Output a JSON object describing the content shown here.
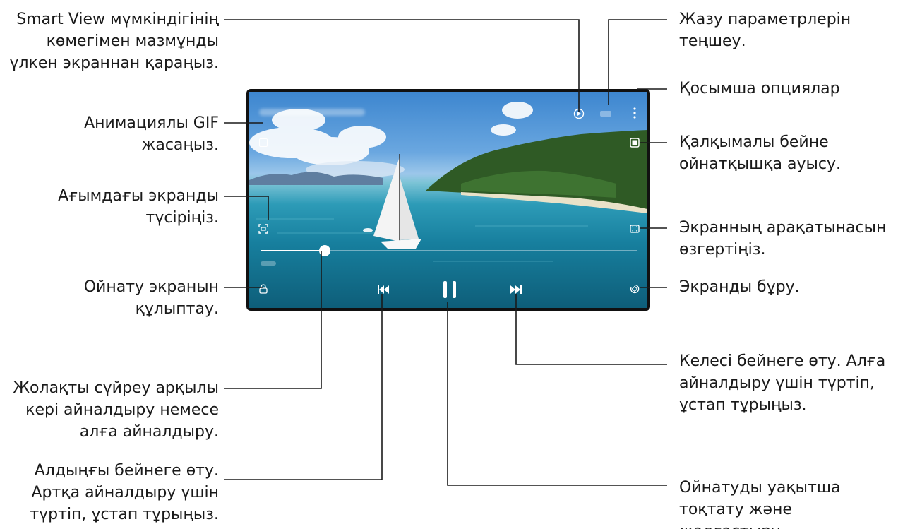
{
  "player": {
    "progress_fraction": 0.17,
    "colors": {
      "accent": "#ffffff",
      "callout_line": "#1a1a1a",
      "water": "#177f9e",
      "sky": "#3d86cf"
    },
    "icons": {
      "smart_view": "smart-view-icon",
      "hdr": "hdr-icon",
      "more": "more-options-icon",
      "gif": "gif-icon",
      "popup": "popup-player-icon",
      "capture": "capture-icon",
      "ratio": "screen-ratio-icon",
      "lock": "lock-icon",
      "rotate": "rotate-icon",
      "previous": "previous-icon",
      "pause": "pause-icon",
      "next": "next-icon"
    }
  },
  "callouts": {
    "smart_view": "Smart View мүмкіндігінің\nкөмегімен мазмұнды\nүлкен экраннан қараңыз.",
    "gif": "Анимациялы GIF\nжасаңыз.",
    "capture": "Ағымдағы экранды\nтүсіріңіз.",
    "lock": "Ойнату экранын\nқұлыптау.",
    "seek": "Жолақты сүйреу арқылы\nкері айналдыру немесе\nалға айналдыру.",
    "previous": "Алдыңғы бейнеге өту.\nАртқа айналдыру үшін\nтүртіп, ұстап тұрыңыз.",
    "record_settings": "Жазу параметрлерін\nтеңшеу.",
    "more": "Қосымша опциялар",
    "popup": "Қалқымалы бейне\nойнатқышқа ауысу.",
    "ratio": "Экранның арақатынасын\nөзгертіңіз.",
    "rotate": "Экранды бұру.",
    "next": "Келесі бейнеге өту. Алға\nайналдыру үшін түртіп,\nұстап тұрыңыз.",
    "pause": "Ойнатуды уақытша\nтоқтату және жалғастыру."
  }
}
